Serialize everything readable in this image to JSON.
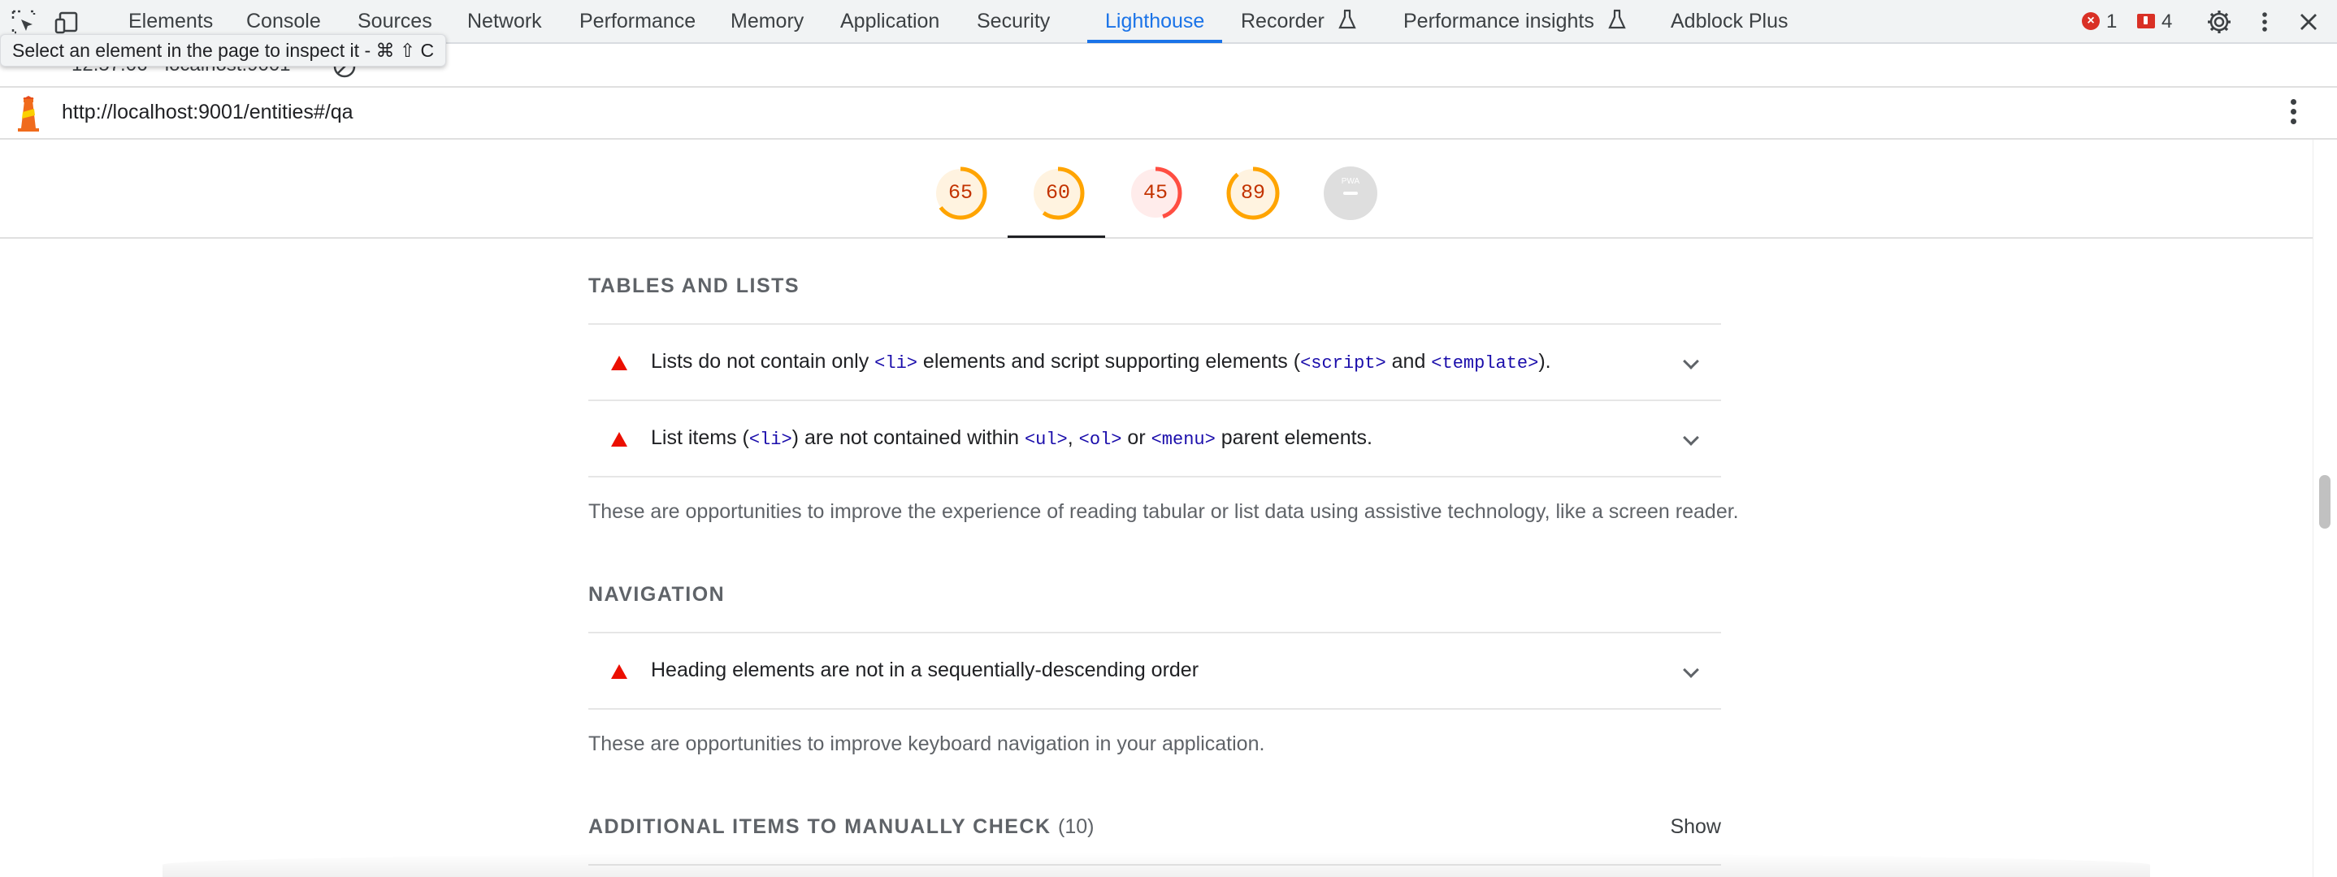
{
  "devtools": {
    "tabs": [
      "Elements",
      "Console",
      "Sources",
      "Network",
      "Performance",
      "Memory",
      "Application",
      "Security",
      "Lighthouse",
      "Recorder",
      "Performance insights",
      "Adblock Plus"
    ],
    "active_tab": "Lighthouse",
    "error_count": "1",
    "issue_count": "4",
    "accent_color": "#1a73e8"
  },
  "report_selector": {
    "text": "12:57:06 - localhost:9001"
  },
  "tooltip": {
    "text": "Select an element in the page to inspect it - ⌘ ⇧ C"
  },
  "report": {
    "url": "http://localhost:9001/entities#/qa"
  },
  "gauges": [
    {
      "score": "65",
      "color": "#ffa400",
      "fraction": 0.65
    },
    {
      "score": "60",
      "color": "#ffa400",
      "fraction": 0.6
    },
    {
      "score": "45",
      "color": "#ff4e42",
      "fraction": 0.45
    },
    {
      "score": "89",
      "color": "#ffa400",
      "fraction": 0.89
    },
    {
      "score": "PWA",
      "color": "#c8c8c8",
      "fraction": 0
    }
  ],
  "groups": {
    "tables_lists": {
      "title": "Tables and lists",
      "audit1": {
        "t1": "Lists do not contain only ",
        "c1": "<li>",
        "t2": " elements and script supporting elements (",
        "c2": "<script>",
        "t3": " and ",
        "c3": "<template>",
        "t4": ")."
      },
      "audit2": {
        "t1": "List items (",
        "c1": "<li>",
        "t2": ") are not contained within ",
        "c2": "<ul>",
        "t3": ", ",
        "c3": "<ol>",
        "t4": " or ",
        "c4": "<menu>",
        "t5": " parent elements."
      },
      "description": "These are opportunities to improve the experience of reading tabular or list data using assistive technology, like a screen reader."
    },
    "navigation": {
      "title": "Navigation",
      "audit1": "Heading elements are not in a sequentially-descending order",
      "description": "These are opportunities to improve keyboard navigation in your application."
    },
    "manual": {
      "title": "Additional items to manually check",
      "count": "(10)",
      "show_label": "Show"
    }
  }
}
